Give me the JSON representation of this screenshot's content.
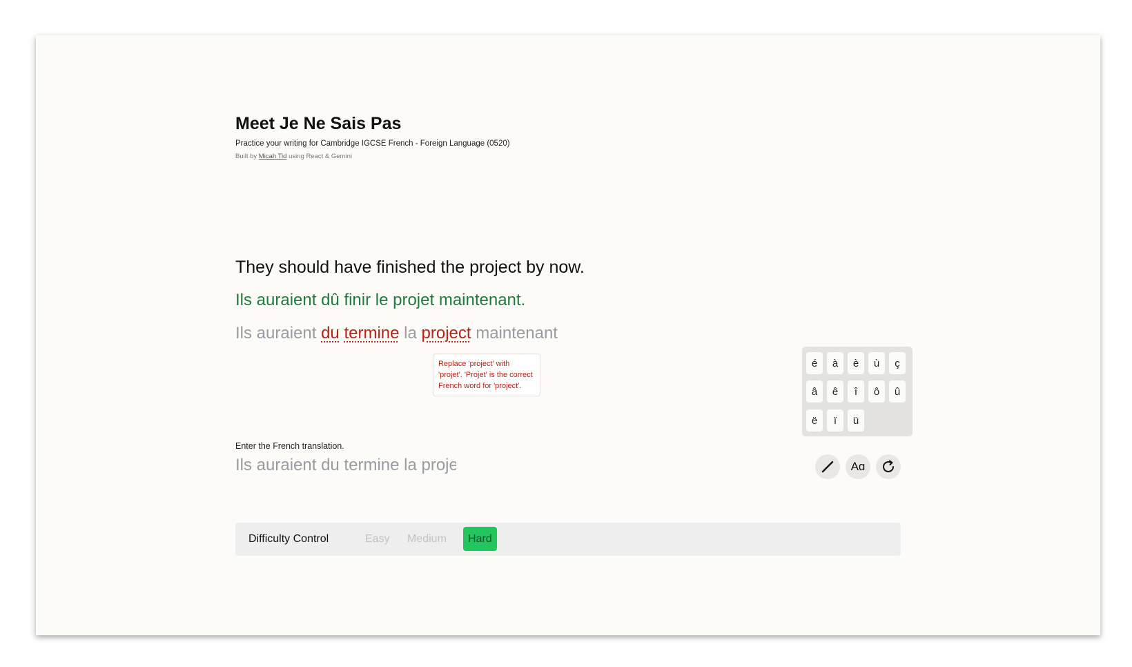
{
  "header": {
    "title": "Meet Je Ne Sais Pas",
    "subtitle": "Practice your writing for Cambridge IGCSE French - Foreign Language (0520)",
    "credit_prefix": "Built by ",
    "credit_author": "Micah Tid",
    "credit_suffix": " using React & Gemini"
  },
  "exercise": {
    "english_sentence": "They should have finished the project by now.",
    "correct_french": "Ils auraient dû finir le projet maintenant.",
    "attempt": {
      "w1": "Ils auraient ",
      "e1": "du",
      "s1": " ",
      "e2": "termine",
      "w2": " la ",
      "e3": "project",
      "w3": " maintenant"
    },
    "tooltip": "Replace 'project' with 'projet'. 'Projet' is the correct French word for 'project'."
  },
  "input": {
    "label": "Enter the French translation.",
    "value": "Ils auraient du termine la project maintenant"
  },
  "accent_keys": [
    "é",
    "à",
    "è",
    "ù",
    "ç",
    "â",
    "ê",
    "î",
    "ô",
    "û",
    "ë",
    "ï",
    "ü"
  ],
  "tools": {
    "pen_icon": "pencil-icon",
    "font_label": "Aɑ",
    "refresh_icon": "refresh-icon"
  },
  "difficulty": {
    "label": "Difficulty Control",
    "options": [
      "Easy",
      "Medium",
      "Hard"
    ],
    "selected": "Hard"
  },
  "colors": {
    "correct": "#1f7a3f",
    "error": "#b42318",
    "selected_difficulty": "#22c55e"
  }
}
